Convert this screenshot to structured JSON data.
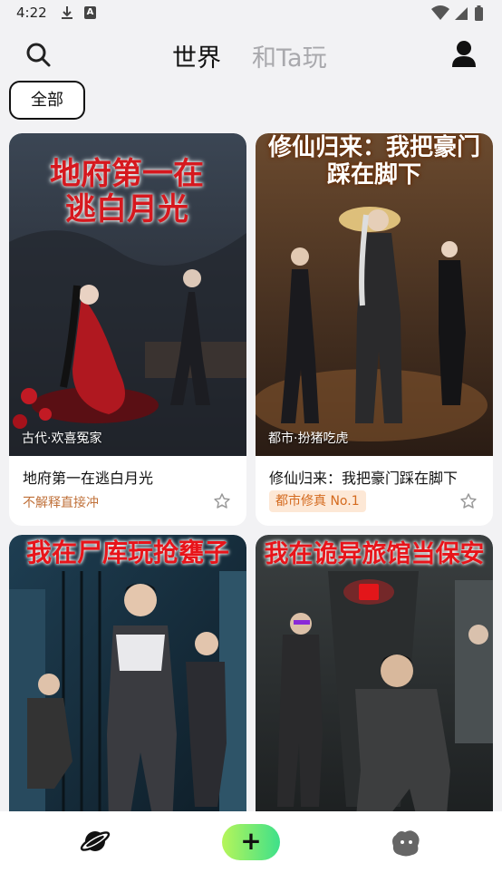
{
  "status_bar": {
    "time": "4:22",
    "icons": [
      "download-icon",
      "a-badge-icon",
      "wifi-icon",
      "signal-icon",
      "battery-icon"
    ]
  },
  "header": {
    "tabs": [
      {
        "label": "世界",
        "active": true
      },
      {
        "label": "和Ta玩",
        "active": false
      }
    ]
  },
  "filter": {
    "label": "全部"
  },
  "cards": [
    {
      "cover_title": "地府第一在逃白月光",
      "tag": "古代·欢喜冤家",
      "title": "地府第一在逃白月光",
      "subtitle": "不解释直接冲"
    },
    {
      "cover_title": "修仙归来：我把豪门踩在脚下",
      "tag": "都市·扮猪吃虎",
      "title": "修仙归来：我把豪门踩在脚下",
      "badge": "都市修真 No.1"
    },
    {
      "cover_title": "我在尸库玩抢甕子"
    },
    {
      "cover_title": "我在诡异旅馆当保安"
    }
  ],
  "bottom_nav": {
    "items": [
      "planet-icon",
      "add-icon",
      "character-icon"
    ],
    "add_label": "+"
  },
  "colors": {
    "background": "#f2f2f4",
    "accent_gradient": [
      "#b6f55a",
      "#3ee08a"
    ],
    "badge_text": "#d46a1e",
    "subtitle_text": "#c0713a",
    "inactive_tab": "#a9a9ad"
  }
}
